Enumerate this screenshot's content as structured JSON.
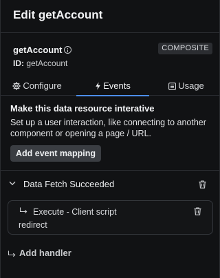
{
  "header": {
    "title": "Edit getAccount"
  },
  "resource": {
    "name": "getAccount",
    "badge": "COMPOSITE",
    "id_label": "ID:",
    "id_value": "getAccount"
  },
  "tabs": [
    {
      "label": "Configure",
      "icon": "gear-icon"
    },
    {
      "label": "Events",
      "icon": "bolt-icon",
      "active": true
    },
    {
      "label": "Usage",
      "icon": "list-icon"
    }
  ],
  "events_section": {
    "title": "Make this data resource interative",
    "description": "Set up a user interaction, like connecting to another component or opening a page / URL.",
    "add_button": "Add event mapping"
  },
  "event": {
    "label": "Data Fetch Succeeded",
    "handler": {
      "title": "Execute - Client script",
      "subtitle": "redirect"
    }
  },
  "add_handler": "Add handler",
  "colors": {
    "background": "#111214",
    "accent": "#4c8df6",
    "button": "#3a3d42"
  }
}
